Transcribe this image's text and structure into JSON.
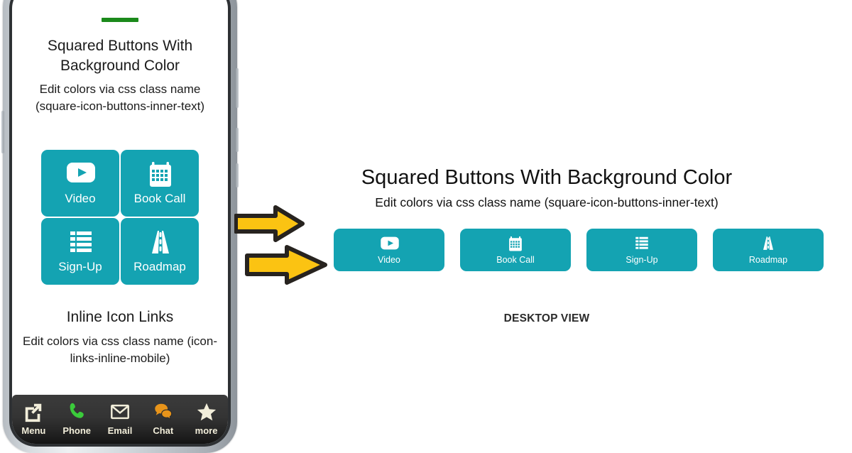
{
  "colors": {
    "button_teal": "#14A3B2",
    "arrow_gold": "#FBC312",
    "arrow_outline": "#27231F",
    "green_divider": "#1B8A1B",
    "phone_bezel": "#2E3134",
    "bottombar_label": "#F2EEDA",
    "phone_icon_phone_green": "#3BCB3B",
    "phone_icon_chat_orange": "#E8941A",
    "page_background": "#FFFFFF"
  },
  "mobile": {
    "title": "Squared Buttons With Background Color",
    "subtitle": "Edit colors via css class name (square-icon-buttons-inner-text)",
    "buttons": [
      {
        "label": "Video",
        "icon": "video-play-icon"
      },
      {
        "label": "Book Call",
        "icon": "calendar-icon"
      },
      {
        "label": "Sign-Up",
        "icon": "list-form-icon"
      },
      {
        "label": "Roadmap",
        "icon": "road-icon"
      }
    ],
    "section2_title": "Inline Icon Links",
    "section2_subtitle": "Edit colors via css class name (icon-links-inline-mobile)",
    "bottom_bar": [
      {
        "label": "Menu",
        "icon": "external-link-icon"
      },
      {
        "label": "Phone",
        "icon": "phone-icon"
      },
      {
        "label": "Email",
        "icon": "envelope-icon"
      },
      {
        "label": "Chat",
        "icon": "chat-bubbles-icon"
      },
      {
        "label": "more",
        "icon": "star-icon"
      }
    ]
  },
  "desktop": {
    "title": "Squared Buttons With Background Color",
    "subtitle": "Edit colors via css class name (square-icon-buttons-inner-text)",
    "buttons": [
      {
        "label": "Video",
        "icon": "video-play-icon"
      },
      {
        "label": "Book Call",
        "icon": "calendar-icon"
      },
      {
        "label": "Sign-Up",
        "icon": "list-form-icon"
      },
      {
        "label": "Roadmap",
        "icon": "road-icon"
      }
    ],
    "caption": "DESKTOP VIEW"
  },
  "arrows": {
    "count": 2,
    "direction": "right",
    "icon": "arrow-right-icon"
  }
}
